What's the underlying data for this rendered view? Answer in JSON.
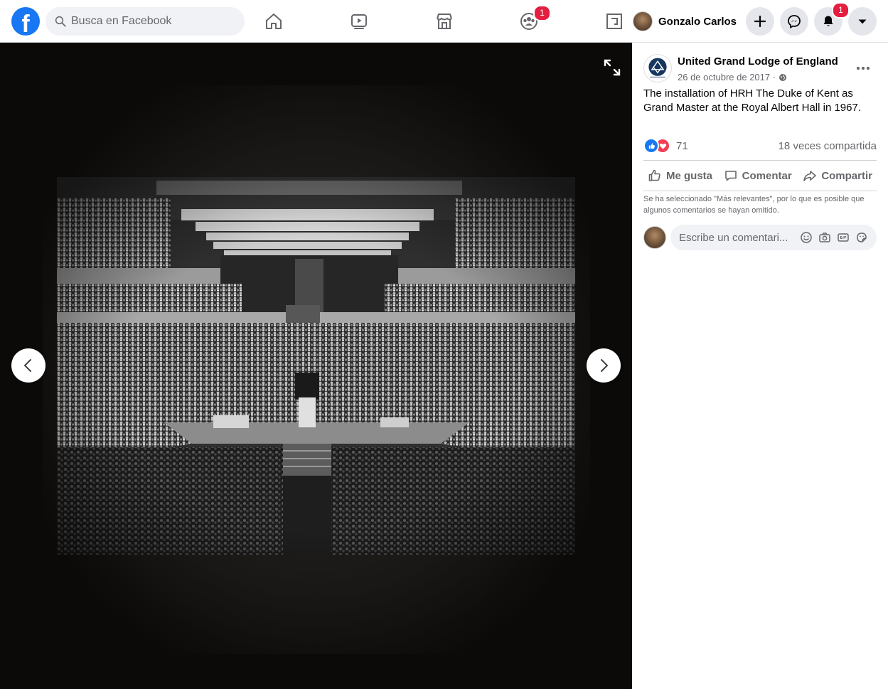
{
  "header": {
    "search_placeholder": "Busca en Facebook",
    "groups_badge": "1",
    "profile_name": "Gonzalo Carlos",
    "notifications_badge": "1"
  },
  "post": {
    "page_name": "United Grand Lodge of England",
    "date": "26 de octubre de 2017 ·",
    "caption": "The installation of HRH The Duke of Kent as Grand Master at the Royal Albert Hall in 1967.",
    "reaction_count": "71",
    "shares": "18 veces compartida"
  },
  "actions": {
    "like": "Me gusta",
    "comment": "Comentar",
    "share": "Compartir"
  },
  "comments": {
    "notice": "Se ha seleccionado \"Más relevantes\", por lo que es posible que algunos comentarios se hayan omitido.",
    "placeholder": "Escribe un comentari..."
  },
  "colors": {
    "brand": "#1877f2",
    "badge": "#e41e3f",
    "love": "#f33e58"
  }
}
